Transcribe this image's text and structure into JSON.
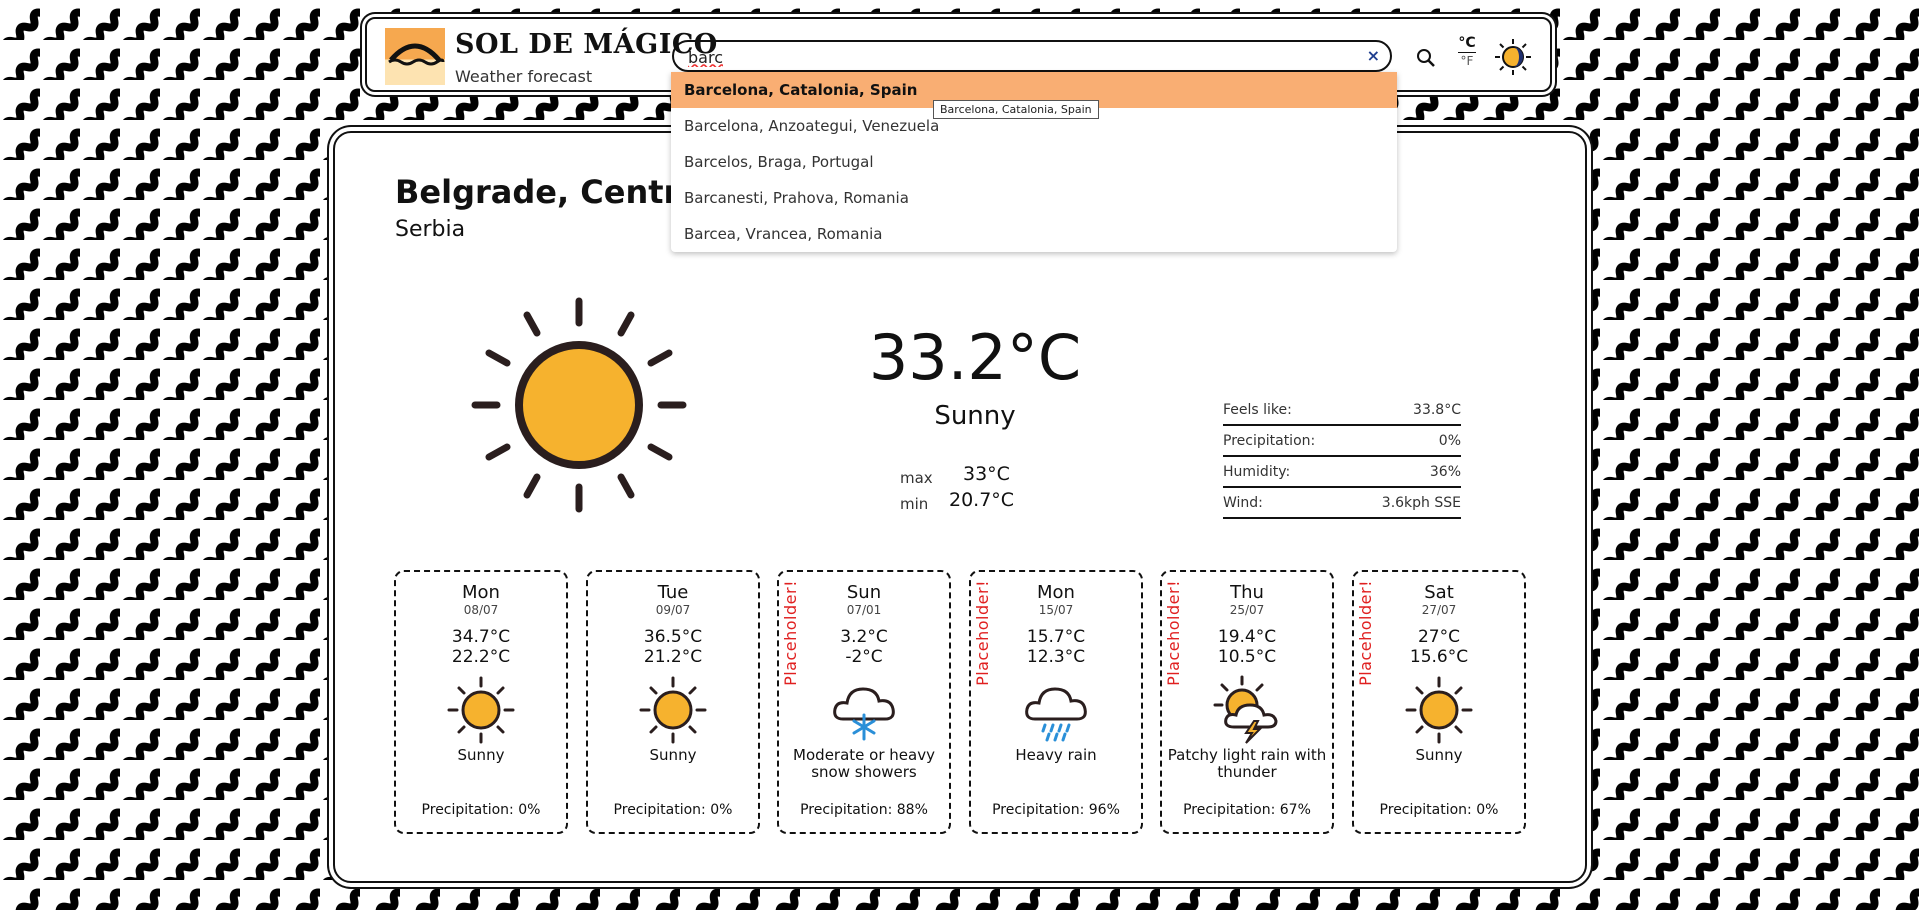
{
  "brand": {
    "title": "SOL DE MÁGICO",
    "subtitle": "Weather forecast"
  },
  "search": {
    "value": "barc",
    "clear_label": "×"
  },
  "units": {
    "celsius": "°C",
    "fahrenheit": "°F"
  },
  "suggestions": [
    "Barcelona, Catalonia, Spain",
    "Barcelona, Anzoategui, Venezuela",
    "Barcelos, Braga, Portugal",
    "Barcanesti, Prahova, Romania",
    "Barcea, Vrancea, Romania"
  ],
  "tooltip": "Barcelona, Catalonia, Spain",
  "current": {
    "city": "Belgrade, Central Serbia",
    "country": "Serbia",
    "temp": "33.2°C",
    "condition": "Sunny",
    "max_label": "max",
    "max": "33°C",
    "min_label": "min",
    "min": "20.7°C",
    "details": [
      {
        "label": "Feels like:",
        "value": "33.8°C"
      },
      {
        "label": "Precipitation:",
        "value": "0%"
      },
      {
        "label": "Humidity:",
        "value": "36%"
      },
      {
        "label": "Wind:",
        "value": "3.6kph SSE"
      }
    ]
  },
  "placeholder_text": "Placeholder!",
  "forecast": [
    {
      "day": "Mon",
      "date": "08/07",
      "max": "34.7°C",
      "min": "22.2°C",
      "condition": "Sunny",
      "icon": "sun-icon",
      "precip": "Precipitation: 0%",
      "placeholder": false
    },
    {
      "day": "Tue",
      "date": "09/07",
      "max": "36.5°C",
      "min": "21.2°C",
      "condition": "Sunny",
      "icon": "sun-icon",
      "precip": "Precipitation: 0%",
      "placeholder": false
    },
    {
      "day": "Sun",
      "date": "07/01",
      "max": "3.2°C",
      "min": "-2°C",
      "condition": "Moderate or heavy snow showers",
      "icon": "snow-cloud-icon",
      "precip": "Precipitation: 88%",
      "placeholder": true
    },
    {
      "day": "Mon",
      "date": "15/07",
      "max": "15.7°C",
      "min": "12.3°C",
      "condition": "Heavy rain",
      "icon": "rain-cloud-icon",
      "precip": "Precipitation: 96%",
      "placeholder": true
    },
    {
      "day": "Thu",
      "date": "25/07",
      "max": "19.4°C",
      "min": "10.5°C",
      "condition": "Patchy light rain with thunder",
      "icon": "thunder-icon",
      "precip": "Precipitation: 67%",
      "placeholder": true
    },
    {
      "day": "Sat",
      "date": "27/07",
      "max": "27°C",
      "min": "15.6°C",
      "condition": "Sunny",
      "icon": "sun-icon",
      "precip": "Precipitation: 0%",
      "placeholder": true
    }
  ],
  "colors": {
    "accent": "#f9ae73",
    "sun": "#f6b22e",
    "placeholder": "#e02020"
  }
}
